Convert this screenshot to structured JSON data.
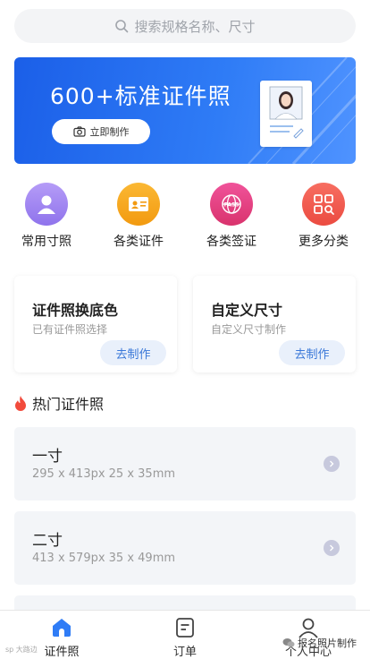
{
  "search": {
    "placeholder": "搜索规格名称、尺寸"
  },
  "banner": {
    "title": "600+标准证件照",
    "button_label": "立即制作"
  },
  "categories": [
    {
      "label": "常用寸照",
      "icon": "person-icon",
      "color": "#9a82f0"
    },
    {
      "label": "各类证件",
      "icon": "id-card-icon",
      "color": "#f7a21b"
    },
    {
      "label": "各类签证",
      "icon": "passport-globe-icon",
      "color": "#e8407e"
    },
    {
      "label": "更多分类",
      "icon": "grid-search-icon",
      "color": "#f25a4f"
    }
  ],
  "cards": [
    {
      "title": "证件照换底色",
      "subtitle": "已有证件照选择",
      "button": "去制作"
    },
    {
      "title": "自定义尺寸",
      "subtitle": "自定义尺寸制作",
      "button": "去制作"
    }
  ],
  "hot_section": {
    "title": "热门证件照",
    "icon": "flame-icon"
  },
  "sizes": [
    {
      "name": "一寸",
      "detail": "295 x 413px  25 x 35mm"
    },
    {
      "name": "二寸",
      "detail": "413 x 579px  35 x 49mm"
    }
  ],
  "tabbar": [
    {
      "label": "证件照",
      "icon": "home-icon",
      "active": true
    },
    {
      "label": "订单",
      "icon": "order-icon",
      "active": false
    },
    {
      "label": "个人中心",
      "icon": "user-icon",
      "active": false
    }
  ],
  "watermark": {
    "left": "sp 大路边",
    "right": "报名照片制作"
  },
  "colors": {
    "primary": "#2f7cf6",
    "accent_button_bg": "#e9f0fb",
    "accent_button_text": "#3a78d8"
  }
}
